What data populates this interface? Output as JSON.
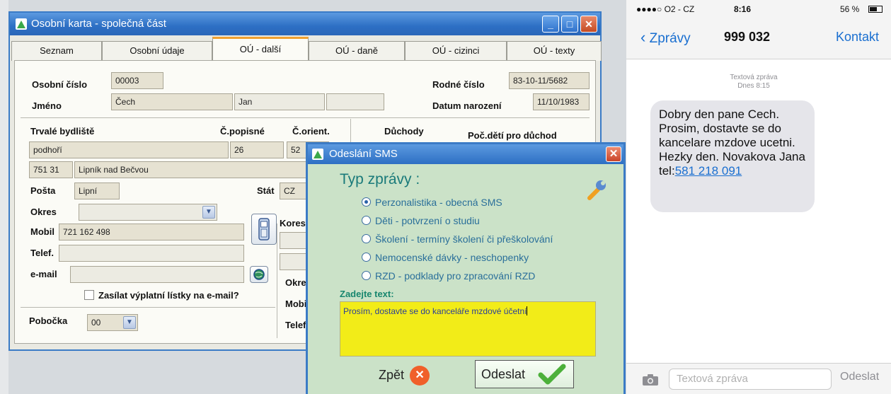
{
  "window": {
    "title": "Osobní karta - společná část",
    "tabs": [
      "Seznam",
      "Osobní údaje",
      "OÚ - další",
      "OÚ - daně",
      "OÚ - cizinci",
      "OÚ - texty"
    ],
    "active_tab": "OÚ - další"
  },
  "form": {
    "osobni_cislo_label": "Osobní číslo",
    "osobni_cislo": "00003",
    "rodne_cislo_label": "Rodné číslo",
    "rodne_cislo": "83-10-11/5682",
    "jmeno_label": "Jméno",
    "prijmeni": "Čech",
    "jmeno": "Jan",
    "datum_narozeni_label": "Datum narození",
    "datum_narozeni": "11/10/1983",
    "trvale_bydliste_label": "Trvalé bydliště",
    "c_popisne_label": "Č.popisné",
    "c_orient_label": "Č.orient.",
    "duchody_label": "Důchody",
    "poc_deti_label": "Poč.dětí pro důchod",
    "ulice": "podhoří",
    "c_popisne": "26",
    "c_orient": "52",
    "psc": "751 31",
    "obec": "Lipník nad Bečvou",
    "posta_label": "Pošta",
    "posta": "Lipní",
    "stat_label": "Stát",
    "stat": "CZ",
    "okres_label": "Okres",
    "mobil_label": "Mobil",
    "mobil": "721 162 498",
    "telef_label": "Telef.",
    "email_label": "e-mail",
    "zasilat_label": "Zasílat výplatní lístky na e-mail?",
    "pobocka_label": "Pobočka",
    "pobocka": "00",
    "kores_label": "Kores",
    "okres2_label": "Okre",
    "mobil2_label": "Mobi",
    "telef2_label": "Telef"
  },
  "sms_dialog": {
    "title": "Odeslání SMS",
    "type_label": "Typ zprávy :",
    "options": [
      "Perzonalistika - obecná SMS",
      "Děti - potvrzení o studiu",
      "Školení - termíny školení či přeškolování",
      "Nemocenské dávky - neschopenky",
      "RZD - podklady pro zpracování RZD"
    ],
    "selected_index": 0,
    "text_label": "Zadejte text:",
    "text_value": "Prosím, dostavte se do kanceláře mzdové účetní",
    "back_label": "Zpět",
    "send_label": "Odeslat"
  },
  "phone": {
    "carrier": "●●●●○ O2 - CZ",
    "time": "8:16",
    "battery": "56 %",
    "back_label": "Zprávy",
    "contact_number": "999 032",
    "contact_button": "Kontakt",
    "msg_meta_1": "Textová zpráva",
    "msg_meta_2": "Dnes 8:15",
    "message_text": "Dobry den pane Cech. Prosim, dostavte se do kancelare mzdove ucetni. Hezky den. Novakova Jana tel:",
    "message_phone": "581 218 091",
    "input_placeholder": "Textová zpráva",
    "send_label": "Odeslat"
  },
  "colors": {
    "titlebar_blue": "#2d6fc4",
    "dialog_green": "#cbe2c8",
    "textarea_yellow": "#f2ec18",
    "ios_blue": "#1a6fd0"
  }
}
